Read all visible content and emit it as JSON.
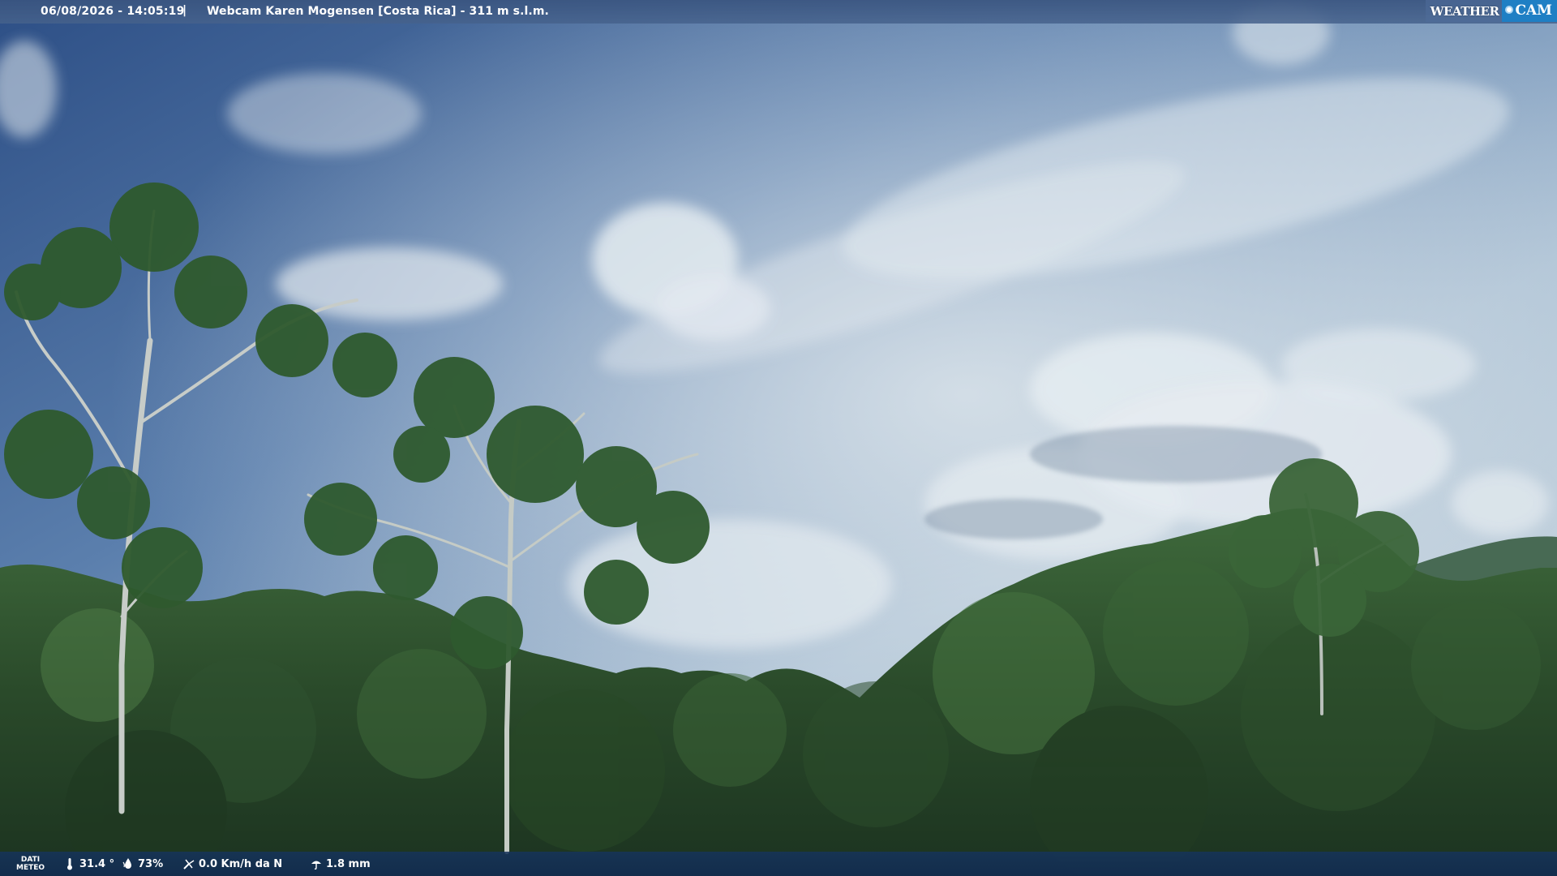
{
  "header": {
    "datetime": "06/08/2026 - 14:05:19",
    "separator": "|",
    "camera_title": "Webcam Karen Mogensen [Costa Rica] - 311 m s.l.m."
  },
  "logo": {
    "word1": "WEATHER",
    "word2": "CAM",
    "accent_color": "#1f7fc4"
  },
  "weather_bar": {
    "label_line1": "DATI",
    "label_line2": "METEO",
    "temperature": "31.4 °",
    "humidity": "73%",
    "wind": "0.0 Km/h da N",
    "rain": "1.8 mm",
    "icons": {
      "temperature": "thermometer-icon",
      "humidity": "humidity-icon",
      "wind": "wind-icon",
      "rain": "rain-icon"
    }
  }
}
